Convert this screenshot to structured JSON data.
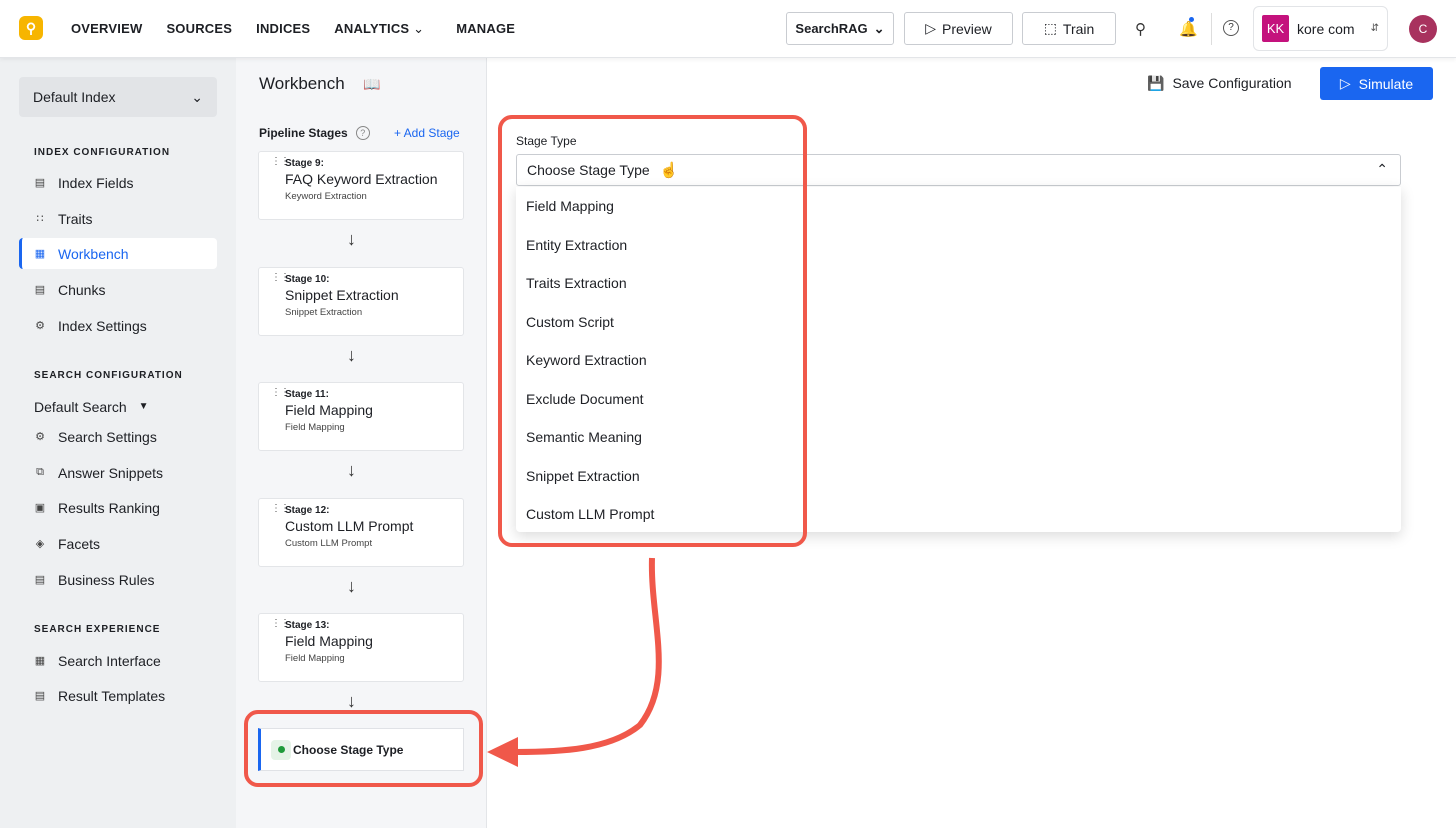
{
  "nav": {
    "items": [
      "OVERVIEW",
      "SOURCES",
      "INDICES",
      "ANALYTICS",
      "MANAGE"
    ]
  },
  "header": {
    "app_select": "SearchRAG",
    "preview": "Preview",
    "train": "Train",
    "user_initials": "KK",
    "user_name": "kore com",
    "avatar": "C"
  },
  "sidebar": {
    "index_select": "Default Index",
    "index_config": {
      "title": "INDEX CONFIGURATION",
      "items": [
        "Index Fields",
        "Traits",
        "Workbench",
        "Chunks",
        "Index Settings"
      ]
    },
    "search_config": {
      "title": "SEARCH CONFIGURATION",
      "select": "Default Search",
      "items": [
        "Search Settings",
        "Answer Snippets",
        "Results Ranking",
        "Facets",
        "Business Rules"
      ]
    },
    "search_exp": {
      "title": "SEARCH EXPERIENCE",
      "items": [
        "Search Interface",
        "Result Templates"
      ]
    }
  },
  "page": {
    "title": "Workbench",
    "save": "Save Configuration",
    "simulate": "Simulate"
  },
  "pipeline": {
    "title": "Pipeline Stages",
    "add": "+ Add Stage",
    "stages": [
      {
        "num": "Stage 9:",
        "name": "FAQ Keyword Extraction",
        "type": "Keyword Extraction"
      },
      {
        "num": "Stage 10:",
        "name": "Snippet Extraction",
        "type": "Snippet Extraction"
      },
      {
        "num": "Stage 11:",
        "name": "Field Mapping",
        "type": "Field Mapping"
      },
      {
        "num": "Stage 12:",
        "name": "Custom LLM Prompt",
        "type": "Custom LLM Prompt"
      },
      {
        "num": "Stage 13:",
        "name": "Field Mapping",
        "type": "Field Mapping"
      }
    ],
    "new_stage": "Choose Stage Type"
  },
  "stage_type": {
    "label": "Stage Type",
    "value": "Choose Stage Type",
    "options": [
      "Field Mapping",
      "Entity Extraction",
      "Traits Extraction",
      "Custom Script",
      "Keyword Extraction",
      "Exclude Document",
      "Semantic Meaning",
      "Snippet Extraction",
      "Custom LLM Prompt"
    ]
  },
  "colors": {
    "accent": "#1a66f0",
    "annotation": "#f0584a",
    "logo": "#f7b500"
  }
}
